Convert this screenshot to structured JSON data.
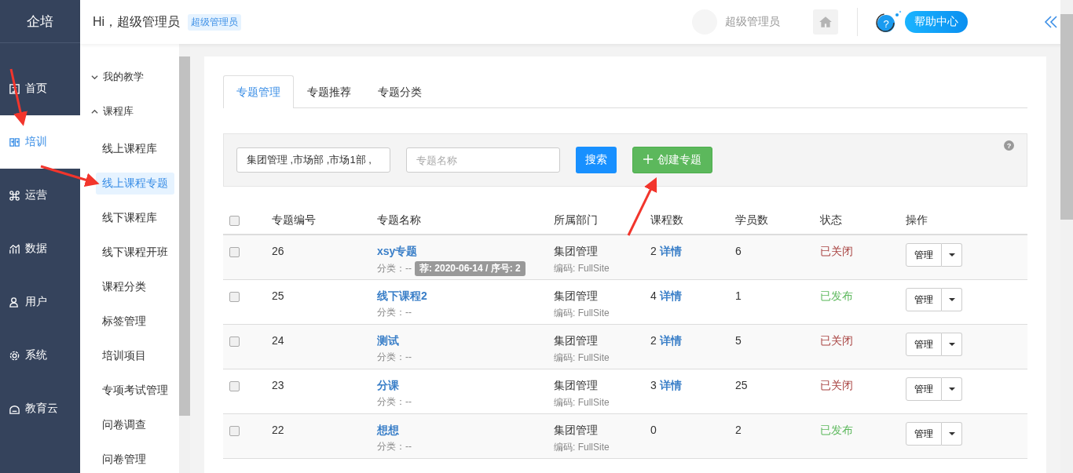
{
  "brand": "企培",
  "header": {
    "greeting": "Hi，超级管理员",
    "role_badge": "超级管理员",
    "user_name": "超级管理员",
    "help_glyph": "?",
    "help_label": "帮助中心"
  },
  "nav": [
    {
      "label": "首页",
      "selected": false
    },
    {
      "label": "培训",
      "selected": true
    },
    {
      "label": "运营",
      "selected": false
    },
    {
      "label": "数据",
      "selected": false
    },
    {
      "label": "用户",
      "selected": false
    },
    {
      "label": "系统",
      "selected": false
    },
    {
      "label": "教育云",
      "selected": false
    }
  ],
  "submenu": [
    {
      "label": "我的教学",
      "expanded": false
    },
    {
      "label": "课程库",
      "expanded": true,
      "children": [
        {
          "label": "线上课程库",
          "selected": false
        },
        {
          "label": "线上课程专题",
          "selected": true
        },
        {
          "label": "线下课程库",
          "selected": false
        },
        {
          "label": "线下课程开班",
          "selected": false
        },
        {
          "label": "课程分类",
          "selected": false
        },
        {
          "label": "标签管理",
          "selected": false
        },
        {
          "label": "培训项目",
          "selected": false
        },
        {
          "label": "专项考试管理",
          "selected": false
        },
        {
          "label": "问卷调查",
          "selected": false
        },
        {
          "label": "问卷管理",
          "selected": false
        }
      ]
    }
  ],
  "tabs": [
    {
      "label": "专题管理",
      "selected": true
    },
    {
      "label": "专题推荐",
      "selected": false
    },
    {
      "label": "专题分类",
      "selected": false
    }
  ],
  "filter": {
    "department": "集团管理 ,市场部 ,市场1部 ,",
    "name_placeholder": "专题名称",
    "search_button": "搜索",
    "create_button": "创建专题",
    "help_glyph": "?"
  },
  "table": {
    "select_all_checked": false,
    "columns": [
      "专题编号",
      "专题名称",
      "所属部门",
      "课程数",
      "学员数",
      "状态",
      "操作"
    ],
    "rows": [
      {
        "checked": false,
        "id": "26",
        "name": "xsy专题",
        "category": "分类：--",
        "tag": "荐: 2020-06-14 / 序号: 2",
        "dept": "集团管理",
        "code": "编码: FullSite",
        "courses": "2",
        "detail": "详情",
        "students": "6",
        "status": "已关闭",
        "kind": "closed",
        "action": "管理"
      },
      {
        "checked": false,
        "id": "25",
        "name": "线下课程2",
        "category": "分类：--",
        "dept": "集团管理",
        "code": "编码: FullSite",
        "courses": "4",
        "detail": "详情",
        "students": "1",
        "status": "已发布",
        "kind": "published",
        "action": "管理"
      },
      {
        "checked": false,
        "id": "24",
        "name": "测试",
        "category": "分类：--",
        "dept": "集团管理",
        "code": "编码: FullSite",
        "courses": "2",
        "detail": "详情",
        "students": "5",
        "status": "已关闭",
        "kind": "closed",
        "action": "管理"
      },
      {
        "checked": false,
        "id": "23",
        "name": "分课",
        "category": "分类：--",
        "dept": "集团管理",
        "code": "编码: FullSite",
        "courses": "3",
        "detail": "详情",
        "students": "25",
        "status": "已关闭",
        "kind": "closed",
        "action": "管理"
      },
      {
        "checked": false,
        "id": "22",
        "name": "想想",
        "category": "分类：--",
        "dept": "集团管理",
        "code": "编码: FullSite",
        "courses": "0",
        "students": "2",
        "status": "已发布",
        "kind": "published",
        "action": "管理"
      }
    ]
  }
}
